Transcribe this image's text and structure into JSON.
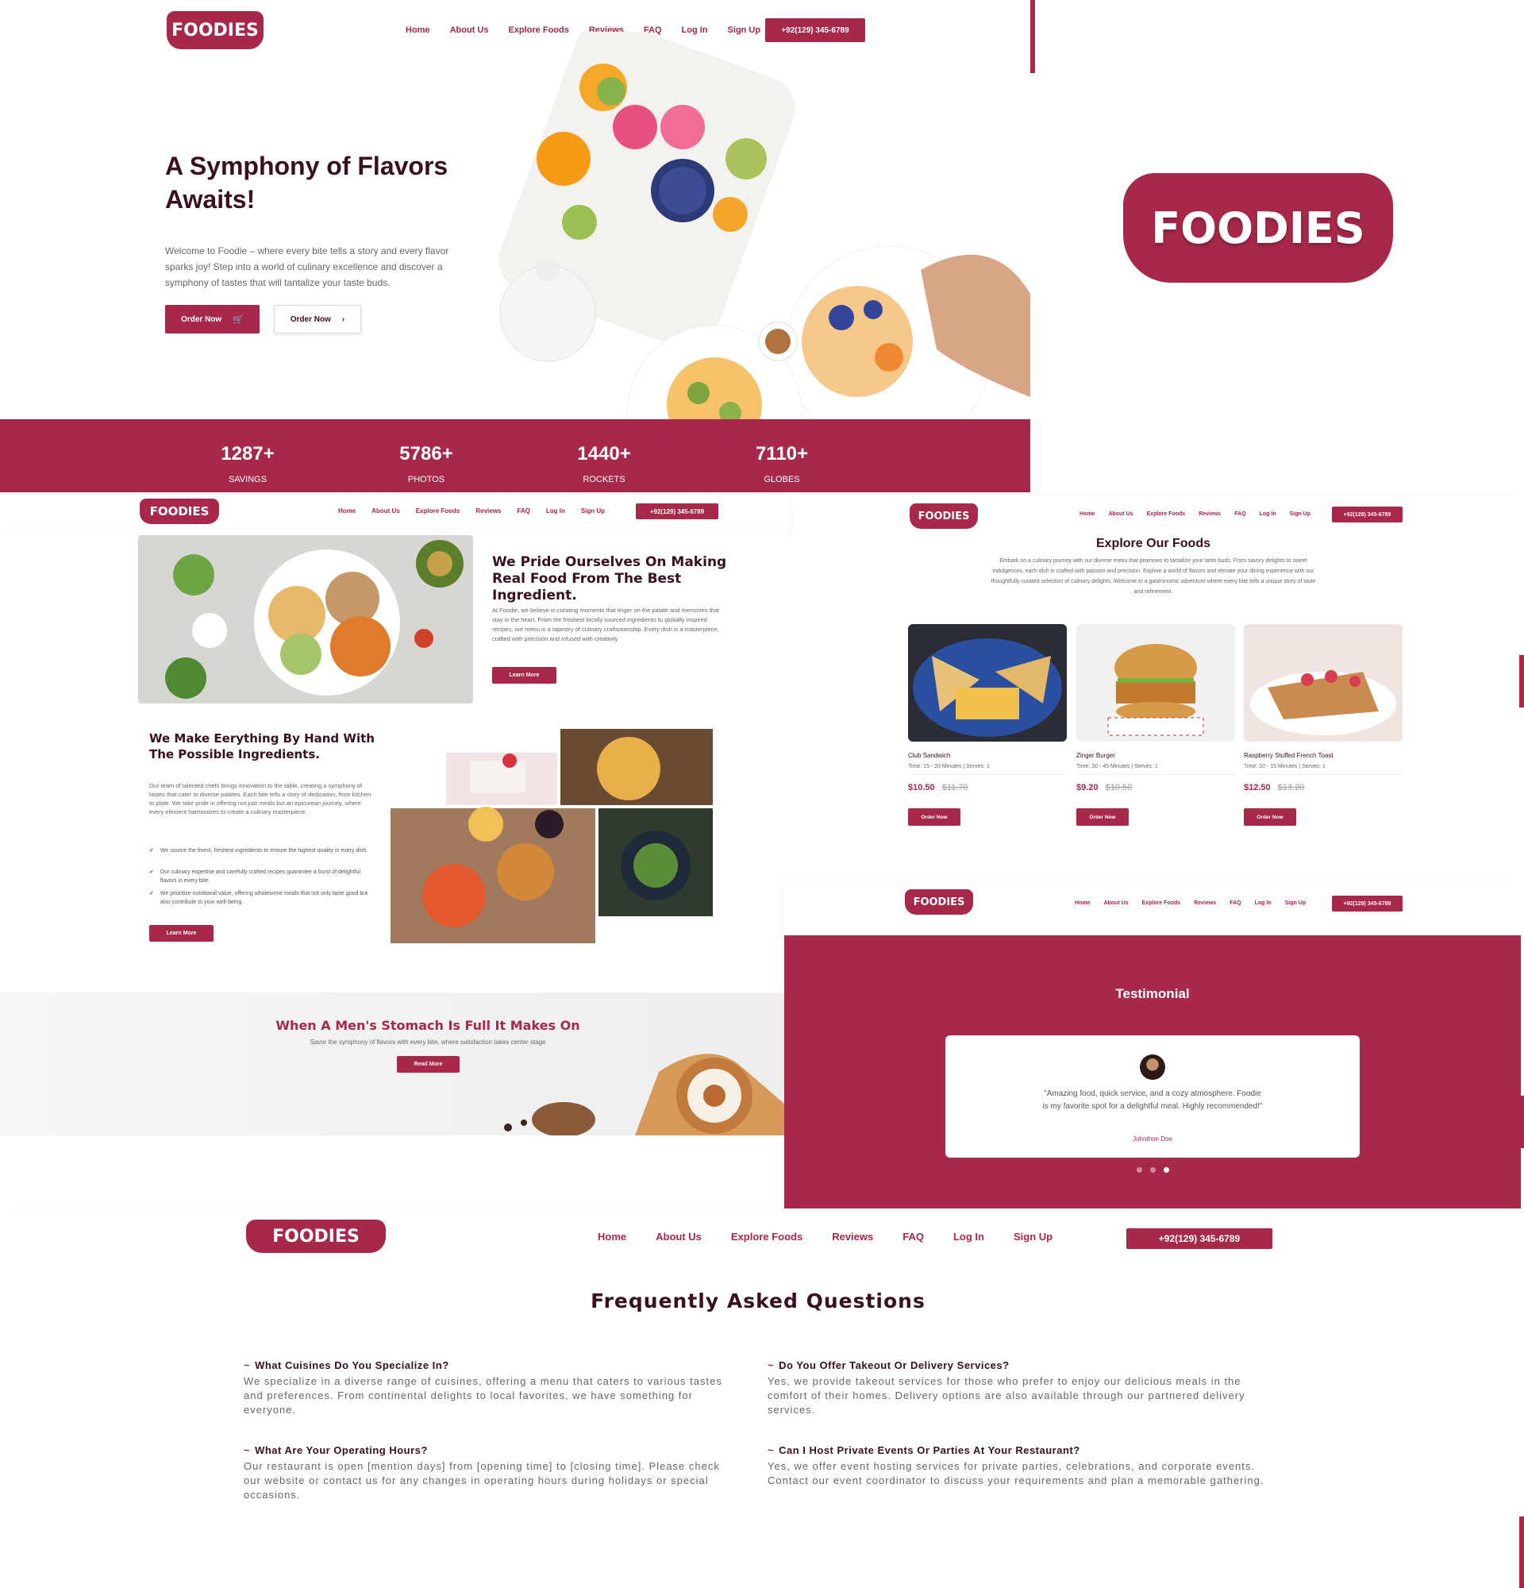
{
  "brand": {
    "name": "FOODIES",
    "primary": "#a8284a",
    "dark": "#3a1020"
  },
  "nav": {
    "items": [
      "Home",
      "About Us",
      "Explore Foods",
      "Reviews",
      "FAQ",
      "Log In",
      "Sign Up"
    ],
    "phone": "+92(129) 345-6789"
  },
  "hero": {
    "title": "A Symphony of Flavors Awaits!",
    "text": "Welcome to Foodie – where every bite tells a story and every flavor sparks joy! Step into a world of culinary excellence and discover a symphony of tastes that will tantalize your taste buds.",
    "btn_primary": "Order Now",
    "btn_primary_icon": "basket-icon",
    "btn_secondary": "Order Now",
    "btn_secondary_icon": "chevron-right-icon"
  },
  "stats": [
    {
      "value": "1287+",
      "label": "SAVINGS"
    },
    {
      "value": "5786+",
      "label": "PHOTOS"
    },
    {
      "value": "1440+",
      "label": "ROCKETS"
    },
    {
      "value": "7110+",
      "label": "GLOBES"
    }
  ],
  "pride": {
    "title": "We Pride Ourselves On Making Real Food From The Best Ingredient.",
    "text": "At Foodie, we believe in curating moments that linger on the palate and memories that stay in the heart. From the freshest locally sourced ingredients to globally inspired recipes, our menu is a tapestry of culinary craftsmanship. Every dish is a masterpiece, crafted with precision and infused with creativity.",
    "btn": "Learn More"
  },
  "hand": {
    "title": "We Make Eerything By Hand With The Possible Ingredients.",
    "text": "Our team of talented chefs brings innovation to the table, creating a symphony of tastes that cater to diverse palates. Each bite tells a story of dedication, from kitchen to plate. We take pride in offering not just meals but an epicurean journey, where every element harmonizes to create a culinary masterpiece.",
    "points": [
      "We source the finest, freshest ingredients to ensure the highest quality in every dish.",
      "Our culinary expertise and carefully crafted recipes guarantee a burst of delightful flavors in every bite.",
      "We prioritize nutritional value, offering wholesome meals that not only taste good but also contribute to your well-being."
    ],
    "btn": "Learn More"
  },
  "banner": {
    "title": "When A Men's Stomach Is Full It Makes On",
    "text": "Savor the symphony of flavors with every bite, where satisfaction takes center stage",
    "btn": "Read More"
  },
  "explore": {
    "title": "Explore Our Foods",
    "text": "Embark on a culinary journey with our diverse menu that promises to tantalize your taste buds. From savory delights to sweet indulgences, each dish is crafted with passion and precision. Explore a world of flavors and elevate your dining experience with our thoughtfully curated selection of culinary delights. Welcome to a gastronomic adventure where every bite tells a unique story of taste and refinement.",
    "items": [
      {
        "name": "Club Sandwich",
        "meta": "Time: 15 - 20 Minutes | Serves: 1",
        "price": "$10.50",
        "old": "$11.70",
        "btn": "Order Now"
      },
      {
        "name": "Zinger Burger",
        "meta": "Time: 30 - 45 Minutes | Serves: 1",
        "price": "$9.20",
        "old": "$10.50",
        "btn": "Order Now"
      },
      {
        "name": "Raspberry Stuffed French Toast",
        "meta": "Time: 10 - 15 Minutes | Serves: 1",
        "price": "$12.50",
        "old": "$13.20",
        "btn": "Order Now"
      }
    ]
  },
  "testimonial": {
    "title": "Testimonial",
    "quote": "\"Amazing food, quick service, and a cozy atmosphere. Foodie is my favorite spot for a delightful meal. Highly recommended!\"",
    "author": "Johnthon Doe"
  },
  "faq": {
    "title": "Frequently Asked Questions",
    "items": [
      {
        "q": "What Cuisines Do You Specialize In?",
        "a": "We specialize in a diverse range of cuisines, offering a menu that caters to various tastes and preferences. From continental delights to local favorites, we have something for everyone."
      },
      {
        "q": "Do You Offer Takeout Or Delivery Services?",
        "a": "Yes, we provide takeout services for those who prefer to enjoy our delicious meals in the comfort of their homes. Delivery options are also available through our partnered delivery services."
      },
      {
        "q": "What Are Your Operating Hours?",
        "a": "Our restaurant is open [mention days] from [opening time] to [closing time]. Please check our website or contact us for any changes in operating hours during holidays or special occasions."
      },
      {
        "q": "Can I Host Private Events Or Parties At Your Restaurant?",
        "a": "Yes, we offer event hosting services for private parties, celebrations, and corporate events. Contact our event coordinator to discuss your requirements and plan a memorable gathering."
      }
    ]
  }
}
